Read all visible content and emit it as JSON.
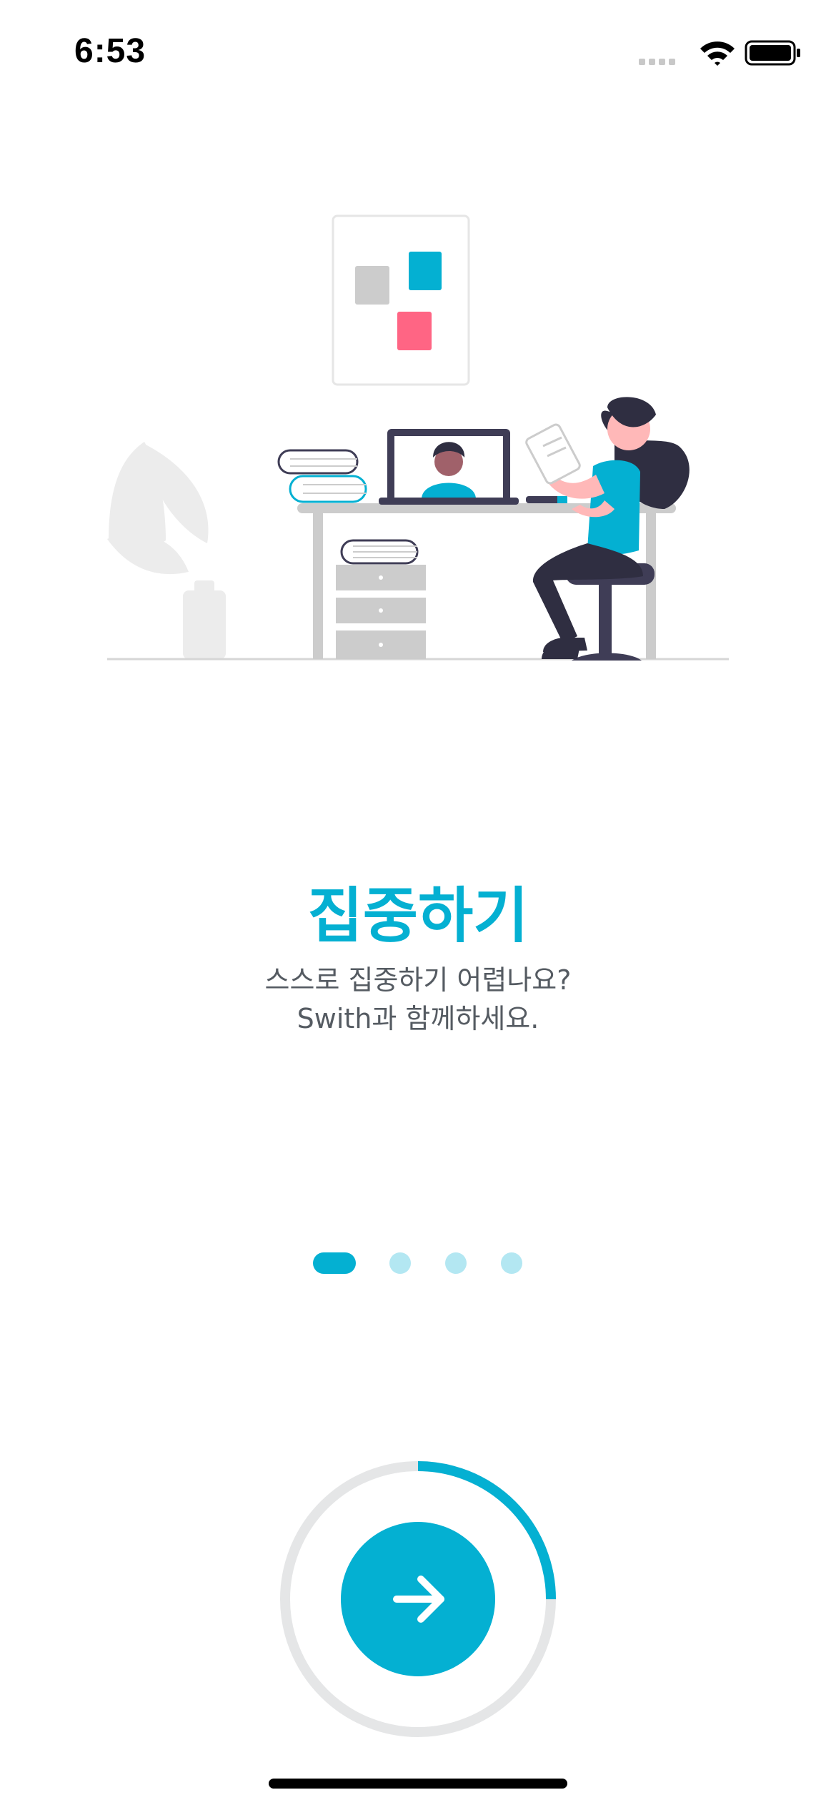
{
  "status_bar": {
    "time": "6:53",
    "icons": [
      "signal-icon",
      "wifi-icon",
      "battery-icon"
    ]
  },
  "onboarding": {
    "title": "집중하기",
    "subtitle_line1": "스스로 집중하기 어렵나요?",
    "subtitle_line2": "Swith과 함께하세요.",
    "current_page": 1,
    "total_pages": 4,
    "progress": 0.25
  },
  "next_button": {
    "icon": "arrow-right-icon"
  },
  "colors": {
    "accent": "#04b0d2",
    "accent_light": "#b3e7f2",
    "pink": "#ff6584",
    "track_gray": "#e5e6e7",
    "text_gray": "#555b62"
  }
}
